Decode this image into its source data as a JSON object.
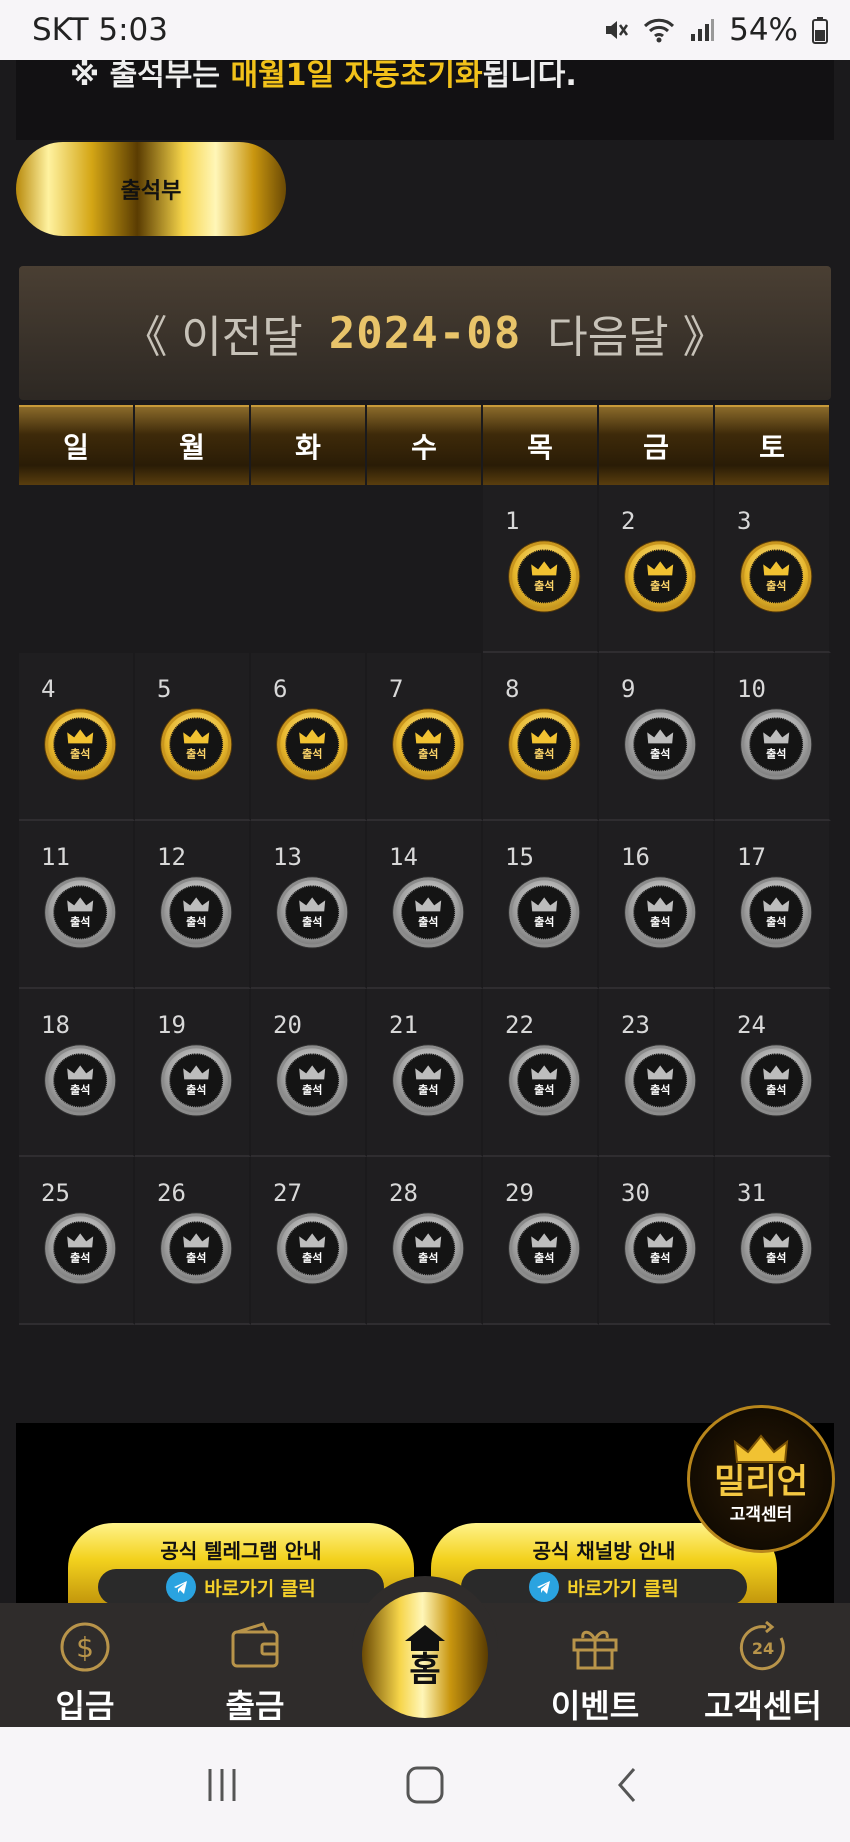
{
  "status_bar": {
    "carrier_time": "SKT 5:03",
    "battery": "54%"
  },
  "notice": {
    "prefix": "※ 출석부는 ",
    "highlight": "매월1일 자동초기화",
    "suffix": "됩니다."
  },
  "pill": {
    "label": "출석부"
  },
  "calendar": {
    "prev_label": "《 이전달",
    "month": "2024-08",
    "next_label": "다음달 》",
    "weekdays": [
      "일",
      "월",
      "화",
      "수",
      "목",
      "금",
      "토"
    ],
    "badge_label": "출석",
    "leading_blanks": 4,
    "attended_days": [
      1,
      2,
      3,
      4,
      5,
      6,
      7,
      8
    ],
    "days_in_month": 31
  },
  "banners": [
    {
      "title": "공식 텔레그램 안내",
      "cta": "바로가기 클릭"
    },
    {
      "title": "공식 채널방 안내",
      "cta": "바로가기 클릭"
    }
  ],
  "cs_badge": {
    "title": "밀리언",
    "subtitle": "고객센터"
  },
  "bottom_nav": {
    "deposit": "입금",
    "withdraw": "출금",
    "home": "홈",
    "event": "이벤트",
    "support": "고객센터"
  },
  "colors": {
    "accent_gold": "#f2c21a",
    "background": "#1b1a1c"
  },
  "icons": [
    "dollar-icon",
    "wallet-icon",
    "home-icon",
    "gift-icon",
    "24h-icon",
    "telegram-icon",
    "crown-icon"
  ]
}
